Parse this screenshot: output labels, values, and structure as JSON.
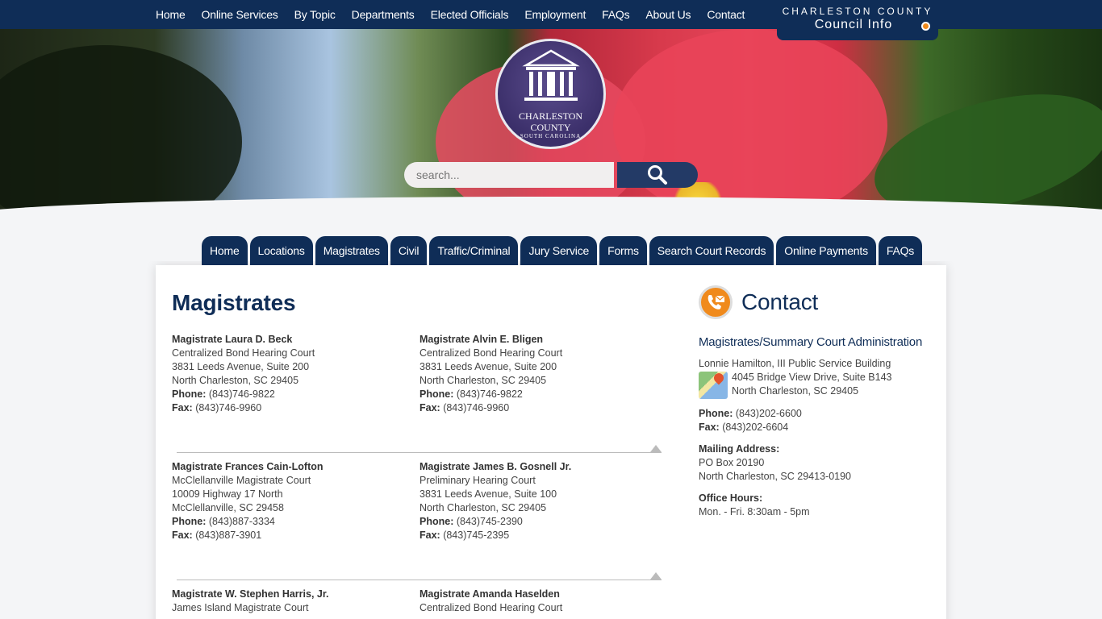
{
  "top_nav": [
    "Home",
    "Online Services",
    "By Topic",
    "Departments",
    "Elected Officials",
    "Employment",
    "FAQs",
    "About Us",
    "Contact"
  ],
  "council": {
    "line1": "CHARLESTON COUNTY",
    "line2": "Council Info"
  },
  "seal": {
    "line1": "CHARLESTON",
    "line2": "COUNTY",
    "line3": "SOUTH CAROLINA"
  },
  "search": {
    "placeholder": "search..."
  },
  "tabs": [
    "Home",
    "Locations",
    "Magistrates",
    "Civil",
    "Traffic/Criminal",
    "Jury Service",
    "Forms",
    "Search Court Records",
    "Online Payments",
    "FAQs"
  ],
  "page_title": "Magistrates",
  "labels": {
    "phone": "Phone:",
    "fax": "Fax:"
  },
  "magistrates": [
    {
      "name": "Magistrate Laura D. Beck",
      "court": "Centralized Bond Hearing Court",
      "address1": "3831 Leeds Avenue, Suite 200",
      "address2": "North Charleston, SC 29405",
      "phone": "(843)746-9822",
      "fax": "(843)746-9960"
    },
    {
      "name": "Magistrate Alvin E. Bligen",
      "court": "Centralized Bond Hearing Court",
      "address1": "3831 Leeds Avenue, Suite 200",
      "address2": "North Charleston, SC 29405",
      "phone": "(843)746-9822",
      "fax": "(843)746-9960"
    },
    {
      "name": "Magistrate Frances Cain-Lofton",
      "court": "McClellanville Magistrate Court",
      "address1": "10009 Highway 17 North",
      "address2": "McClellanville, SC 29458",
      "phone": "(843)887-3334",
      "fax": "(843)887-3901"
    },
    {
      "name": "Magistrate James B. Gosnell Jr.",
      "court": "Preliminary Hearing Court",
      "address1": "3831 Leeds Avenue, Suite 100",
      "address2": "North Charleston, SC 29405",
      "phone": "(843)745-2390",
      "fax": "(843)745-2395"
    },
    {
      "name": "Magistrate W. Stephen Harris, Jr.",
      "court": "James Island Magistrate Court"
    },
    {
      "name": "Magistrate Amanda Haselden",
      "court": "Centralized Bond Hearing Court"
    }
  ],
  "contact": {
    "title": "Contact",
    "subtitle": "Magistrates/Summary Court Administration",
    "building": "Lonnie Hamilton, III Public Service Building",
    "address1": "4045 Bridge View Drive, Suite B143",
    "address2": "North Charleston, SC 29405",
    "phone_label": "Phone:",
    "phone": "(843)202-6600",
    "fax_label": "Fax:",
    "fax": "(843)202-6604",
    "mailing_label": "Mailing Address:",
    "mailing1": "PO Box 20190",
    "mailing2": "North Charleston, SC 29413-0190",
    "hours_label": "Office Hours:",
    "hours": "Mon. - Fri. 8:30am - 5pm"
  },
  "colors": {
    "navy": "#0f2d57",
    "accent_orange": "#f08a1c"
  },
  "icons": [
    "search-icon",
    "contact-phone-icon",
    "map-icon",
    "notification-dot-icon"
  ]
}
